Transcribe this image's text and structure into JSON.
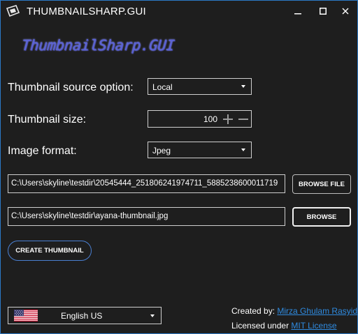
{
  "window": {
    "title": "THUMBNAILSHARP.GUI"
  },
  "logo": {
    "text": "ThumbnailSharp.GUI"
  },
  "form": {
    "source_label": "Thumbnail source option:",
    "source_value": "Local",
    "size_label": "Thumbnail size:",
    "size_value": "100",
    "format_label": "Image format:",
    "format_value": "Jpeg",
    "source_path": "C:\\Users\\skyline\\testdir\\20545444_251806241974711_5885238600011719",
    "target_path": "C:\\Users\\skyline\\testdir\\ayana-thumbnail.jpg"
  },
  "buttons": {
    "browse_file": "BROWSE FILE",
    "browse": "BROWSE",
    "create": "CREATE THUMBNAIL"
  },
  "language": {
    "selected": "English US"
  },
  "credits": {
    "created_by_label": "Created by:",
    "author": "Mirza Ghulam Rasyid",
    "licensed_label": "Licensed under",
    "license": "MIT License"
  },
  "icons": {
    "app": "app-icon",
    "minimize": "minimize-icon",
    "maximize": "maximize-icon",
    "close": "close-icon",
    "plus": "plus-icon",
    "minus": "minus-icon",
    "flag": "us-flag-icon"
  },
  "colors": {
    "background": "#1e1e1e",
    "window_border": "#2b79c7",
    "link": "#2f8be0",
    "logo": "#5a62d6",
    "create_border": "#4a7fd1"
  }
}
